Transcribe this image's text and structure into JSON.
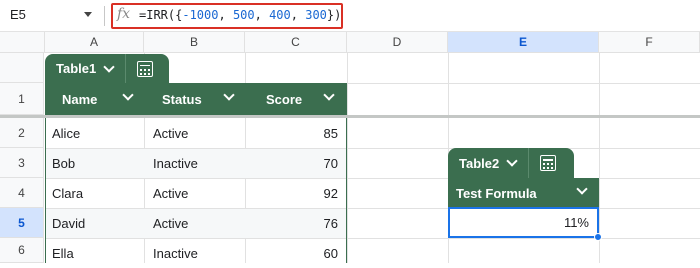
{
  "formula_bar": {
    "cell_ref": "E5",
    "fx_icon": "fx-icon",
    "formula_prefix": "=IRR({",
    "args": [
      "-1000",
      "500",
      "400",
      "300"
    ],
    "formula_suffix": "})"
  },
  "columns": [
    "A",
    "B",
    "C",
    "D",
    "E",
    "F"
  ],
  "rows": [
    "1",
    "2",
    "3",
    "4",
    "5",
    "6"
  ],
  "active_cell": {
    "column": "E",
    "row": "5"
  },
  "table1": {
    "name": "Table1",
    "headers": [
      "Name",
      "Status",
      "Score"
    ],
    "data": [
      [
        "Alice",
        "Active",
        "85"
      ],
      [
        "Bob",
        "Inactive",
        "70"
      ],
      [
        "Clara",
        "Active",
        "92"
      ],
      [
        "David",
        "Active",
        "76"
      ],
      [
        "Ella",
        "Inactive",
        "60"
      ]
    ]
  },
  "table2": {
    "name": "Table2",
    "header": "Test Formula",
    "value": "11%"
  },
  "colors": {
    "table_header": "#3b6e4f",
    "selection": "#1a73e8",
    "formula_highlight_border": "#d93025"
  }
}
